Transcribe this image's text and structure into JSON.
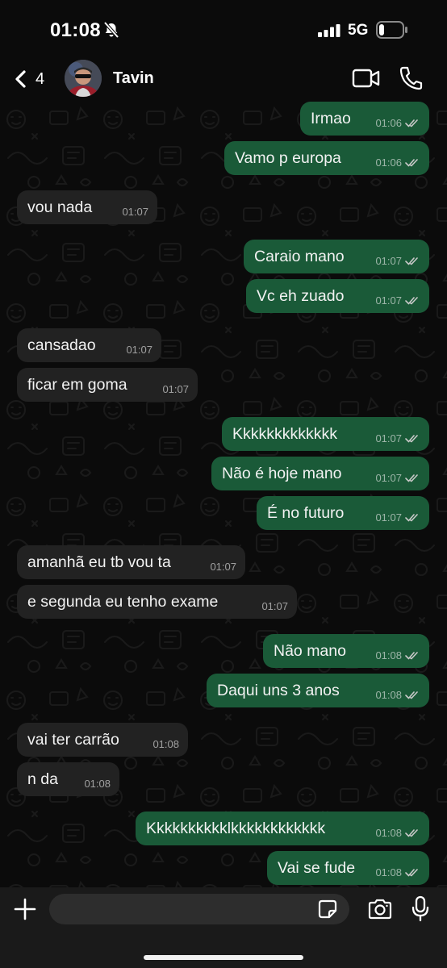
{
  "status_bar": {
    "time": "01:08",
    "network": "5G",
    "silent_icon": "bell-slash-icon",
    "signal_icon": "signal-bars-icon",
    "battery_icon": "battery-low-icon"
  },
  "header": {
    "back_count": "4",
    "contact_name": "Tavin",
    "video_icon": "video-camera-icon",
    "call_icon": "phone-icon"
  },
  "messages": [
    {
      "dir": "out",
      "text": "Irmao",
      "time": "01:06"
    },
    {
      "dir": "out",
      "text": "Vamo p europa",
      "time": "01:06"
    },
    {
      "dir": "in",
      "text": "vou nada",
      "time": "01:07"
    },
    {
      "dir": "out",
      "text": "Caraio mano",
      "time": "01:07"
    },
    {
      "dir": "out",
      "text": "Vc eh zuado",
      "time": "01:07"
    },
    {
      "dir": "in",
      "text": "cansadao",
      "time": "01:07"
    },
    {
      "dir": "in",
      "text": "ficar em goma",
      "time": "01:07"
    },
    {
      "dir": "out",
      "text": "Kkkkkkkkkkkkk",
      "time": "01:07"
    },
    {
      "dir": "out",
      "text": "Não é hoje mano",
      "time": "01:07"
    },
    {
      "dir": "out",
      "text": "É no futuro",
      "time": "01:07"
    },
    {
      "dir": "in",
      "text": "amanhã eu tb vou ta",
      "time": "01:07"
    },
    {
      "dir": "in",
      "text": "e segunda eu tenho exame",
      "time": "01:07"
    },
    {
      "dir": "out",
      "text": "Não mano",
      "time": "01:08"
    },
    {
      "dir": "out",
      "text": "Daqui uns 3 anos",
      "time": "01:08"
    },
    {
      "dir": "in",
      "text": "vai ter carrão",
      "time": "01:08"
    },
    {
      "dir": "in",
      "text": "n da",
      "time": "01:08"
    },
    {
      "dir": "out",
      "text": "Kkkkkkkkkklkkkkkkkkkkkk",
      "time": "01:08"
    },
    {
      "dir": "out",
      "text": "Vai se fude",
      "time": "01:08"
    }
  ],
  "input_bar": {
    "value": "",
    "plus_icon": "plus-icon",
    "sticker_icon": "sticker-icon",
    "camera_icon": "camera-icon",
    "mic_icon": "microphone-icon"
  },
  "colors": {
    "background": "#0b0b0b",
    "outgoing_bubble": "#1a5a38",
    "incoming_bubble": "#222222",
    "input_bar": "#1a1a1a"
  }
}
